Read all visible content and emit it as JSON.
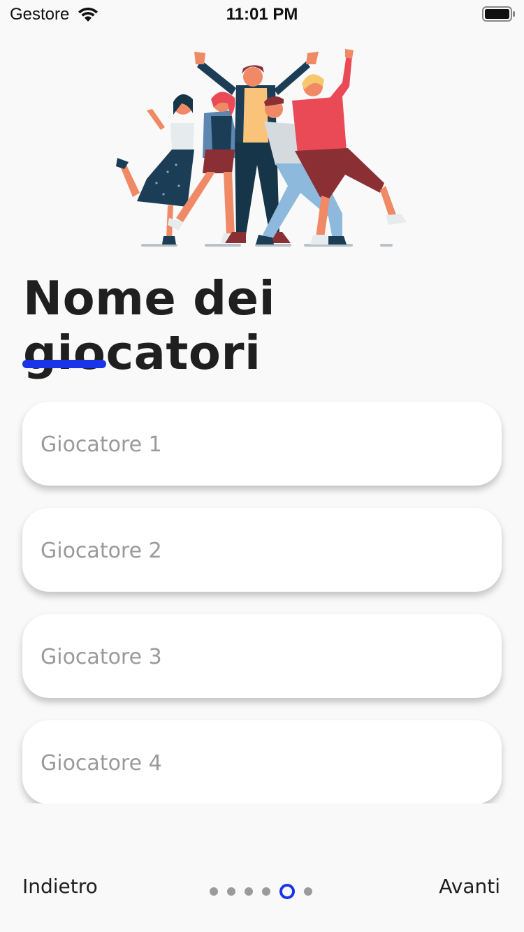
{
  "status_bar": {
    "carrier": "Gestore",
    "time": "11:01 PM"
  },
  "title": "Nome dei giocatori",
  "players": [
    {
      "placeholder": "Giocatore 1"
    },
    {
      "placeholder": "Giocatore 2"
    },
    {
      "placeholder": "Giocatore 3"
    },
    {
      "placeholder": "Giocatore 4"
    }
  ],
  "nav": {
    "back_label": "Indietro",
    "next_label": "Avanti",
    "pages_total": 6,
    "page_active": 5
  },
  "colors": {
    "accent": "#1a35e8",
    "background": "#f9f9f9"
  }
}
